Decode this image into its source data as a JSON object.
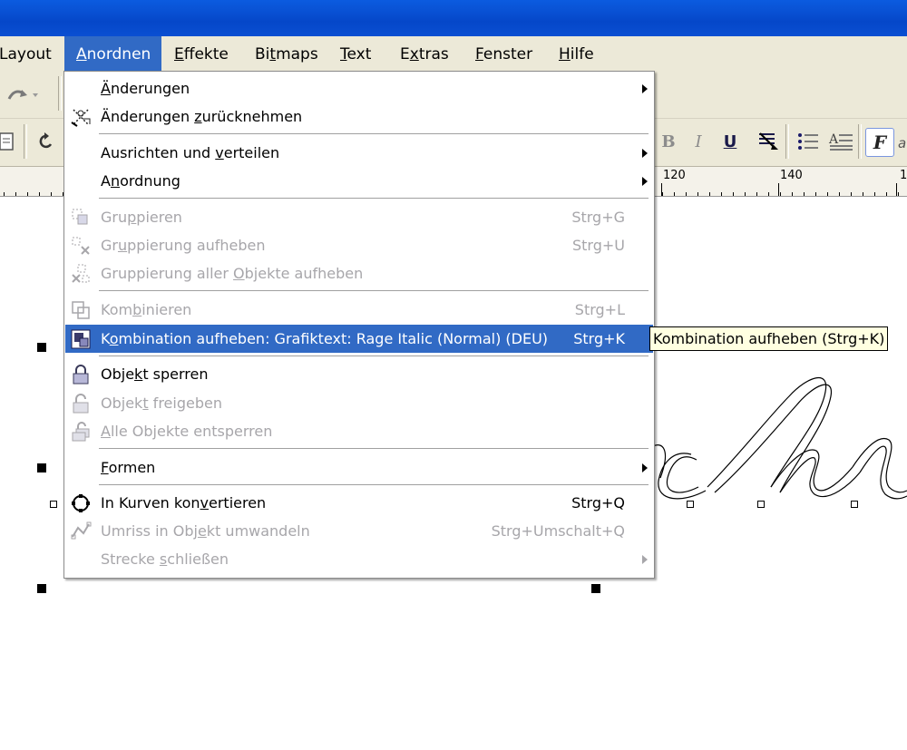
{
  "menubar": {
    "items": [
      {
        "label_pre": "",
        "label_ul": "",
        "label_post": "Layout"
      },
      {
        "label_pre": "",
        "label_ul": "A",
        "label_post": "nordnen"
      },
      {
        "label_pre": "",
        "label_ul": "E",
        "label_post": "ffekte"
      },
      {
        "label_pre": "Bi",
        "label_ul": "t",
        "label_post": "maps"
      },
      {
        "label_pre": "",
        "label_ul": "T",
        "label_post": "ext"
      },
      {
        "label_pre": "E",
        "label_ul": "x",
        "label_post": "tras"
      },
      {
        "label_pre": "",
        "label_ul": "F",
        "label_post": "enster"
      },
      {
        "label_pre": "",
        "label_ul": "H",
        "label_post": "ilfe"
      }
    ]
  },
  "ruler": {
    "labels": [
      "120",
      "140",
      "1"
    ]
  },
  "toolbar2": {
    "bold_glyph": "B",
    "italic_glyph": "I",
    "underline_glyph": "U",
    "font_glyph": "F"
  },
  "menu": {
    "items": [
      {
        "pre": "",
        "ul": "Ä",
        "post": "nderungen",
        "shortcut": ""
      },
      {
        "pre": "Änderungen ",
        "ul": "z",
        "post": "urücknehmen",
        "shortcut": ""
      },
      {
        "pre": "Ausrichten und ",
        "ul": "v",
        "post": "erteilen",
        "shortcut": ""
      },
      {
        "pre": "A",
        "ul": "n",
        "post": "ordnung",
        "shortcut": ""
      },
      {
        "pre": "Gru",
        "ul": "p",
        "post": "pieren",
        "shortcut": "Strg+G"
      },
      {
        "pre": "Gr",
        "ul": "u",
        "post": "ppierung aufheben",
        "shortcut": "Strg+U"
      },
      {
        "pre": "Gruppierung aller ",
        "ul": "O",
        "post": "bjekte aufheben",
        "shortcut": ""
      },
      {
        "pre": "Kom",
        "ul": "b",
        "post": "inieren",
        "shortcut": "Strg+L"
      },
      {
        "pre": "K",
        "ul": "o",
        "post": "mbination aufheben: Grafiktext: Rage Italic (Normal) (DEU)",
        "shortcut": "Strg+K"
      },
      {
        "pre": "Obje",
        "ul": "k",
        "post": "t sperren",
        "shortcut": ""
      },
      {
        "pre": "Objek",
        "ul": "t",
        "post": " freigeben",
        "shortcut": ""
      },
      {
        "pre": "",
        "ul": "A",
        "post": "lle Objekte entsperren",
        "shortcut": ""
      },
      {
        "pre": "",
        "ul": "F",
        "post": "ormen",
        "shortcut": ""
      },
      {
        "pre": "In Kurven kon",
        "ul": "v",
        "post": "ertieren",
        "shortcut": "Strg+Q"
      },
      {
        "pre": "Umriss in Obj",
        "ul": "e",
        "post": "kt umwandeln",
        "shortcut": "Strg+Umschalt+Q"
      },
      {
        "pre": "Strecke ",
        "ul": "s",
        "post": "chließen",
        "shortcut": ""
      }
    ]
  },
  "tooltip": {
    "text": "Kombination aufheben (Strg+K)"
  },
  "colors": {
    "highlight": "#316ac5",
    "menubar": "#ece9d8",
    "titlebar": "#0a55d8",
    "tooltip_bg": "#ffffe1"
  }
}
